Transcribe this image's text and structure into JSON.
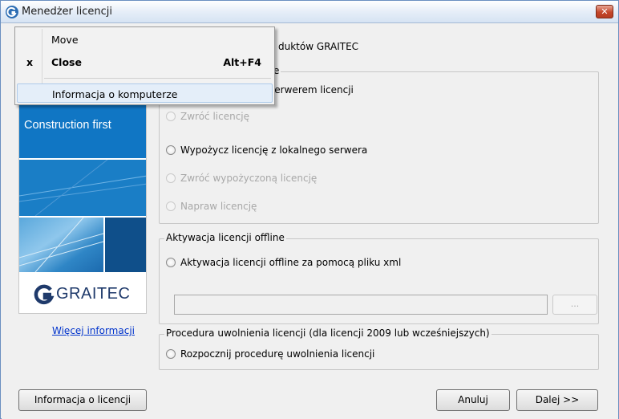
{
  "window": {
    "title": "Menedżer licencji",
    "close_glyph": "✕"
  },
  "header_partial": "duktów GRAITEC",
  "banner": {
    "tagline": "Construction first",
    "logo_text": "GRAITEC"
  },
  "more_info_link": "Więcej informacji",
  "online_group": {
    "legend_partial": "e",
    "options": [
      {
        "label": "Połącz z lokalnym serwerem licencji",
        "shown": "połącz z lokalnym serwerem licencji",
        "enabled": true
      },
      {
        "label": "Zwróć licencję",
        "enabled": false
      },
      {
        "label": "Wypożycz licencję z lokalnego serwera",
        "enabled": true
      },
      {
        "label": "Zwróć wypożyczoną licencję",
        "enabled": false
      },
      {
        "label": "Napraw licencję",
        "enabled": false
      }
    ]
  },
  "offline_group": {
    "legend": "Aktywacja licencji offline",
    "option": "Aktywacja licencji offline za pomocą pliku xml",
    "path_value": "",
    "browse_label": "..."
  },
  "release_group": {
    "legend": "Procedura uwolnienia licencji (dla licencji 2009 lub wcześniejszych)",
    "option": "Rozpocznij procedurę uwolnienia licencji"
  },
  "buttons": {
    "license_info": "Informacja o licencji",
    "cancel": "Anuluj",
    "next": "Dalej >>"
  },
  "system_menu": {
    "items": [
      {
        "label": "Move",
        "accelerator": "",
        "mark": ""
      },
      {
        "label": "Close",
        "accelerator": "Alt+F4",
        "mark": "x"
      },
      {
        "label": "Informacja o komputerze",
        "accelerator": "",
        "mark": ""
      }
    ],
    "highlighted_index": 2
  }
}
